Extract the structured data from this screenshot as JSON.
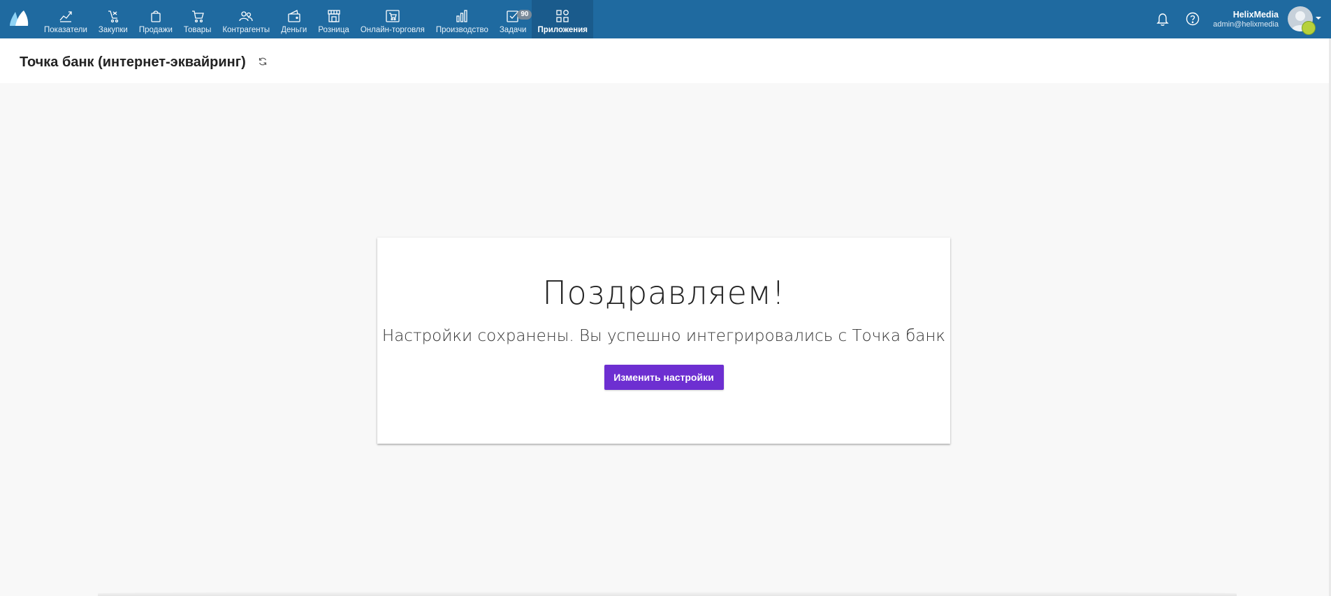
{
  "nav": {
    "items": [
      {
        "label": "Показатели",
        "icon": "chart-line-icon"
      },
      {
        "label": "Закупки",
        "icon": "purchases-icon"
      },
      {
        "label": "Продажи",
        "icon": "shopping-bag-icon"
      },
      {
        "label": "Товары",
        "icon": "cart-icon"
      },
      {
        "label": "Контрагенты",
        "icon": "people-icon"
      },
      {
        "label": "Деньги",
        "icon": "wallet-icon"
      },
      {
        "label": "Розница",
        "icon": "store-icon"
      },
      {
        "label": "Онлайн-торговля",
        "icon": "online-store-icon"
      },
      {
        "label": "Производство",
        "icon": "bar-chart-icon"
      },
      {
        "label": "Задачи",
        "icon": "checkbox-icon",
        "badge": "90"
      },
      {
        "label": "Приложения",
        "icon": "apps-grid-icon",
        "active": true
      }
    ]
  },
  "user": {
    "name": "HelixMedia",
    "email": "admin@helixmedia"
  },
  "page": {
    "title": "Точка банк (интернет-эквайринг)"
  },
  "card": {
    "title": "Поздравляем!",
    "text": "Настройки сохранены. Вы успешно интегрировались с Точка банк",
    "button_label": "Изменить настройки"
  },
  "colors": {
    "topbar": "#1f6aa0",
    "topbar_active": "#1a5b8c",
    "button": "#6d2fd1",
    "background": "#f8f8f8"
  }
}
